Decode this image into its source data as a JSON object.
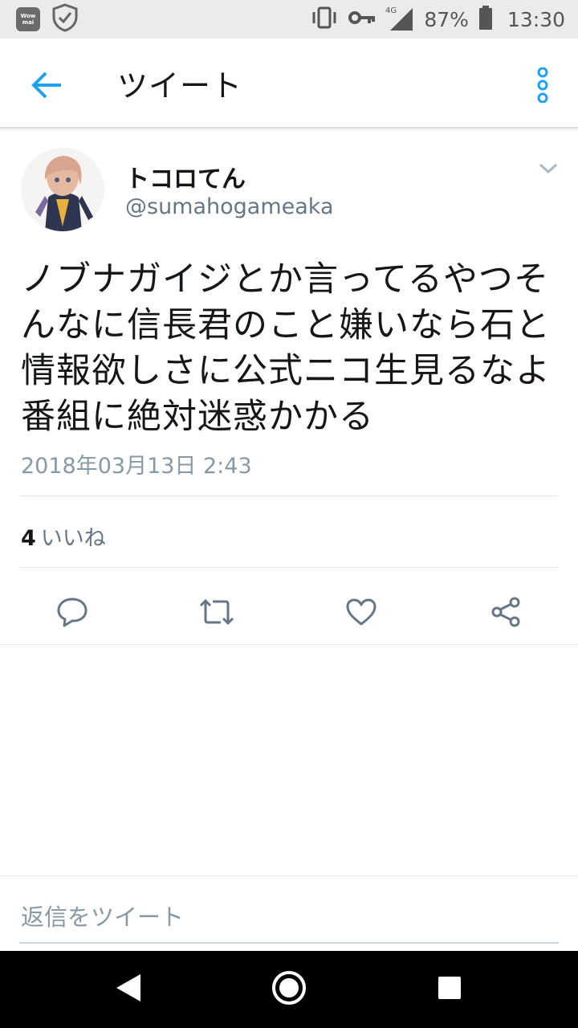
{
  "status_bar": {
    "app_icon_text": "Wow mai",
    "battery": "87%",
    "time": "13:30",
    "network": "4G"
  },
  "appbar": {
    "title": "ツイート"
  },
  "tweet": {
    "display_name": "トコロてん",
    "handle": "@sumahogameaka",
    "text": "ノブナガイジとか言ってるやつそんなに信長君のこと嫌いなら石と情報欲しさに公式ニコ生見るなよ番組に絶対迷惑かかる",
    "timestamp": "2018年03月13日 2:43",
    "likes_count": "4",
    "likes_label": "いいね"
  },
  "reply": {
    "placeholder": "返信をツイート"
  },
  "colors": {
    "accent": "#1da1f2",
    "text": "#14171a",
    "secondary": "#657786",
    "icon": "#657786"
  }
}
